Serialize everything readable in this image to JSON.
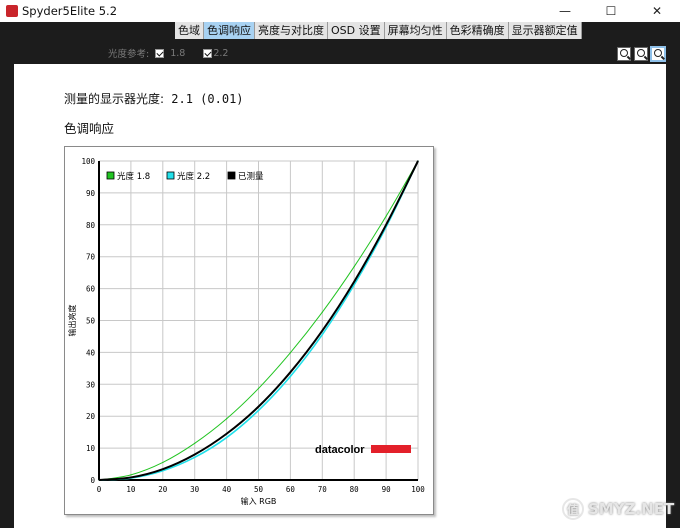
{
  "window": {
    "title": "Spyder5Elite 5.2"
  },
  "tabs": [
    {
      "label": "色域",
      "active": false
    },
    {
      "label": "色调响应",
      "active": true
    },
    {
      "label": "亮度与对比度",
      "active": false
    },
    {
      "label": "OSD 设置",
      "active": false
    },
    {
      "label": "屏幕均匀性",
      "active": false
    },
    {
      "label": "色彩精确度",
      "active": false
    },
    {
      "label": "显示器额定值",
      "active": false
    }
  ],
  "gamma_ref": {
    "label": "光度参考:",
    "options": [
      {
        "label": "1.8",
        "checked": true
      },
      {
        "label": "2.2",
        "checked": true
      }
    ]
  },
  "zoom": {
    "buttons": [
      "zoom-in",
      "zoom-out",
      "zoom-fit"
    ]
  },
  "report": {
    "measured_label": "测量的显示器光度:",
    "measured_value": "2.1 (0.01)",
    "section_title": "色调响应"
  },
  "colors": {
    "accent_tab": "#a8d2f2",
    "series_18": "#22c422",
    "series_22": "#22e0ea",
    "series_measured": "#000000",
    "brand_red": "#e3202a"
  },
  "watermark": "SMYZ.NET",
  "chart_data": {
    "type": "line",
    "title": "",
    "xlabel": "输入 RGB",
    "ylabel": "输出亮度",
    "xlim": [
      0,
      100
    ],
    "ylim": [
      0,
      100
    ],
    "xticks": [
      0,
      10,
      20,
      30,
      40,
      50,
      60,
      70,
      80,
      90,
      100
    ],
    "yticks": [
      0,
      10,
      20,
      30,
      40,
      50,
      60,
      70,
      80,
      90,
      100
    ],
    "grid": true,
    "legend_position": "top-left",
    "brand": "datacolor",
    "series": [
      {
        "name": "光度 1.8",
        "color": "#22c422",
        "x": [
          0,
          10,
          20,
          30,
          40,
          50,
          60,
          70,
          80,
          90,
          100
        ],
        "y": [
          0,
          1.6,
          5.5,
          11.5,
          19.2,
          28.7,
          39.9,
          52.6,
          66.9,
          82.7,
          100
        ]
      },
      {
        "name": "光度 2.2",
        "color": "#22e0ea",
        "x": [
          0,
          10,
          20,
          30,
          40,
          50,
          60,
          70,
          80,
          90,
          100
        ],
        "y": [
          0,
          0.6,
          2.9,
          7.1,
          13.3,
          21.8,
          32.5,
          45.6,
          61.2,
          79.3,
          100
        ]
      },
      {
        "name": "已测量",
        "color": "#000000",
        "x": [
          0,
          10,
          20,
          30,
          40,
          50,
          60,
          70,
          80,
          90,
          100
        ],
        "y": [
          0,
          0.8,
          3.4,
          8.0,
          14.5,
          23.0,
          33.8,
          46.8,
          62.2,
          80.0,
          100
        ]
      }
    ]
  }
}
